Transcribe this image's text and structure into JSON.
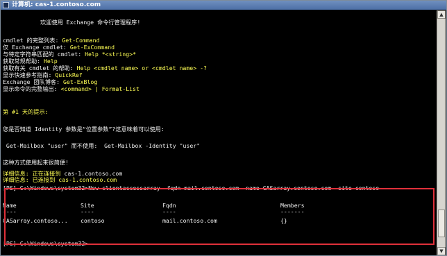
{
  "window": {
    "title": "计算机: cas-1.contoso.com"
  },
  "console": {
    "welcome": "欢迎使用 Exchange 命令行管理程序!",
    "help": [
      {
        "label": "cmdlet 的完整列表: ",
        "cmd": "Get-Command"
      },
      {
        "label": "仅 Exchange cmdlet: ",
        "cmd": "Get-ExCommand"
      },
      {
        "label": "与特定字符串匹配的 cmdlet: ",
        "cmd": "Help *<string>*"
      },
      {
        "label": "获取常规帮助: ",
        "cmd": "Help"
      },
      {
        "label": "获取有关 cmdlet 的帮助: ",
        "cmd": "Help <cmdlet name> or <cmdlet name> -?"
      },
      {
        "label": "显示快速参考指南: ",
        "cmd": "QuickRef"
      },
      {
        "label": "Exchange 团队博客: ",
        "cmd": "Get-ExBlog"
      },
      {
        "label": "显示命令的完整输出: ",
        "cmd": "<command> | Format-List"
      }
    ],
    "tip_heading": "第 #1 天的提示:",
    "tip_line1": "您是否知道 Identity 参数是“位置参数”?这意味着可以使用:",
    "tip_line2": " Get-Mailbox \"user\" 而不使用:  Get-Mailbox -Identity \"user\"",
    "tip_line3": "这种方式使用起来很简便!",
    "verbose1_label": "详细信息: 正在连接到 ",
    "verbose1_host": "cas-1.contoso.com",
    "verbose2": "详细信息: 已连接到 cas-1.contoso.com",
    "prompt": "[PS] C:\\Windows\\system32>",
    "command": "New-clientaccessarray -fqdn mail.contoso.com -name CASarray.contoso.com -site contoso",
    "table": {
      "headers": [
        "Name",
        "Site",
        "Fqdn",
        "Members"
      ],
      "separators": [
        "----",
        "----",
        "----",
        "-------"
      ],
      "rows": [
        [
          "CASarray.contoso...",
          "contoso",
          "mail.contoso.com",
          "{}"
        ]
      ]
    },
    "final_prompt": "[PS] C:\\Windows\\system32>"
  }
}
